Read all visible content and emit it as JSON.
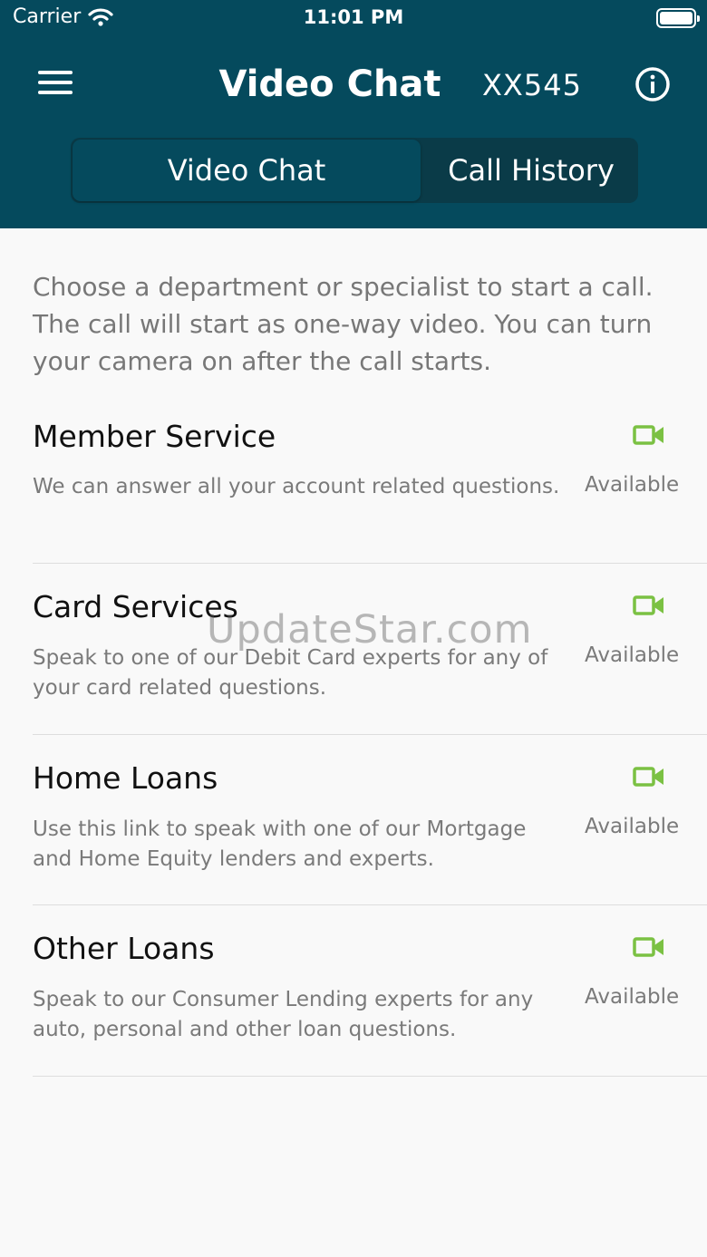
{
  "status_bar": {
    "carrier": "Carrier",
    "time": "11:01 PM"
  },
  "nav": {
    "title": "Video Chat",
    "account": "XX545"
  },
  "tabs": [
    {
      "label": "Video Chat"
    },
    {
      "label": "Call History"
    }
  ],
  "intro": "Choose a department or specialist to start a call. The call will start as one-way video. You can turn your camera on after the call starts.",
  "departments": [
    {
      "title": "Member Service",
      "description": "We can answer all your account related questions.",
      "status": "Available"
    },
    {
      "title": "Card Services",
      "description": "Speak to one of our Debit Card experts for any of your card related questions.",
      "status": "Available"
    },
    {
      "title": "Home Loans",
      "description": "Use this link to speak with one of our Mortgage and Home Equity lenders and experts.",
      "status": "Available"
    },
    {
      "title": "Other Loans",
      "description": "Speak to our Consumer Lending experts for any auto, personal and other loan questions.",
      "status": "Available"
    }
  ],
  "watermark": "UpdateStar.com",
  "colors": {
    "header": "#054a5d",
    "available_icon": "#7bc143"
  }
}
